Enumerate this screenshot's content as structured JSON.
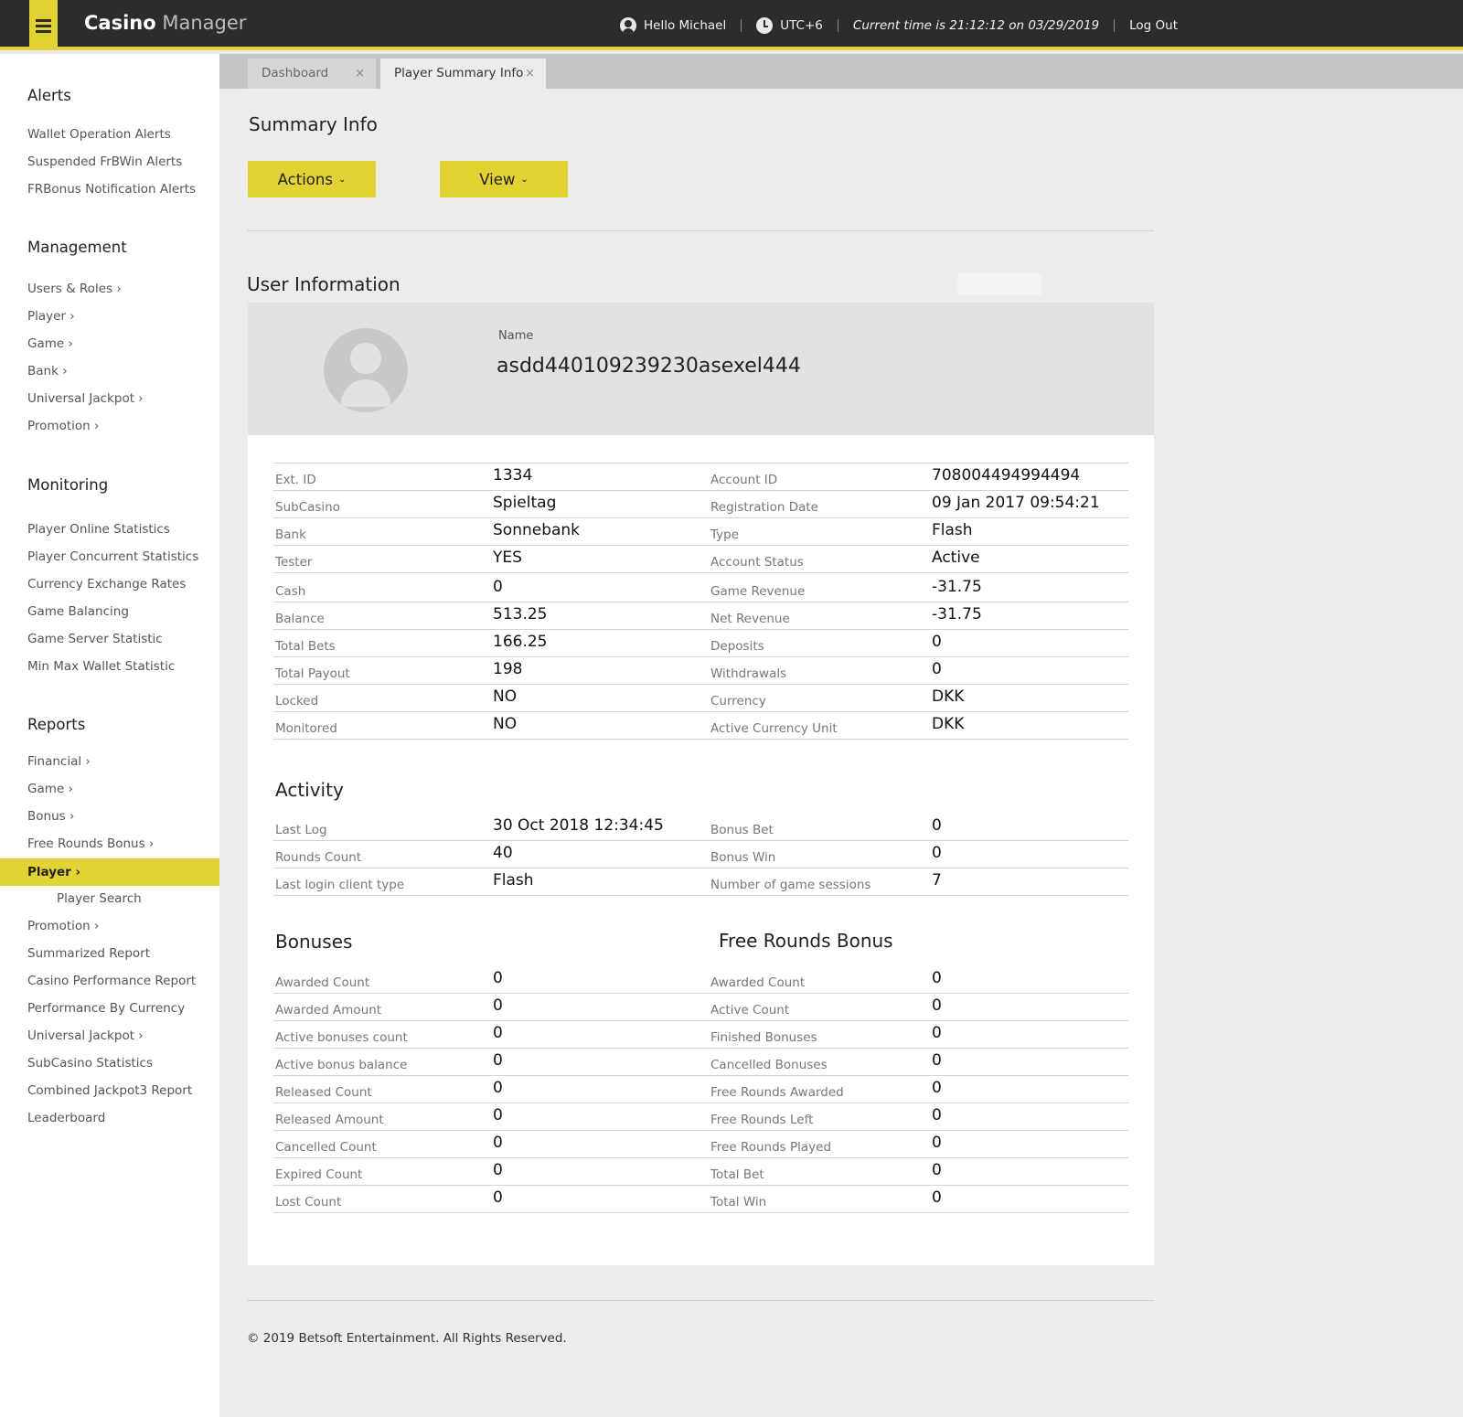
{
  "header": {
    "brand_bold": "Casino",
    "brand_light": "Manager",
    "greeting": "Hello Michael",
    "timezone": "UTC+6",
    "current_time": "Current time is 21:12:12 on 03/29/2019",
    "logout": "Log Out"
  },
  "sidebar": {
    "alerts": {
      "title": "Alerts",
      "items": [
        "Wallet Operation Alerts",
        "Suspended FrBWin Alerts",
        "FRBonus Notification Alerts"
      ]
    },
    "management": {
      "title": "Management",
      "items": [
        "Users & Roles ›",
        "Player ›",
        "Game ›",
        "Bank ›",
        "Universal Jackpot ›",
        "Promotion ›"
      ]
    },
    "monitoring": {
      "title": "Monitoring",
      "items": [
        "Player Online Statistics",
        "Player Concurrent Statistics",
        "Currency Exchange Rates",
        "Game Balancing",
        "Game Server Statistic",
        "Min Max Wallet Statistic"
      ]
    },
    "reports": {
      "title": "Reports",
      "items_before": [
        "Financial ›",
        "Game ›",
        "Bonus ›",
        "Free Rounds Bonus ›"
      ],
      "active": "Player ›",
      "sub_item": "Player Search",
      "items_after": [
        "Promotion ›",
        "Summarized Report",
        "Casino Performance Report",
        "Performance By Currency",
        "Universal Jackpot ›",
        "SubCasino Statistics",
        "Combined Jackpot3 Report",
        "Leaderboard"
      ]
    }
  },
  "tabs": [
    {
      "label": "Dashboard",
      "close": "×"
    },
    {
      "label": "Player Summary Info",
      "close": "×"
    }
  ],
  "page": {
    "title": "Summary Info",
    "actions_label": "Actions",
    "view_label": "View",
    "chevron": "⌄",
    "section_title": "User Information"
  },
  "user": {
    "name_label": "Name",
    "name": "asdd440109239230asexel444"
  },
  "info_rows": [
    {
      "l1": "Ext. ID",
      "v1": "1334",
      "l2": "Account ID",
      "v2": "708004494994494"
    },
    {
      "l1": "SubCasino",
      "v1": "Spieltag",
      "l2": "Registration Date",
      "v2": "09 Jan 2017 09:54:21"
    },
    {
      "l1": "Bank",
      "v1": "Sonnebank",
      "l2": "Type",
      "v2": "Flash"
    },
    {
      "l1": "Tester",
      "v1": "YES",
      "l2": "Account Status",
      "v2": "Active"
    }
  ],
  "money_rows": [
    {
      "l1": "Cash",
      "v1": "0",
      "l2": "Game Revenue",
      "v2": "-31.75"
    },
    {
      "l1": "Balance",
      "v1": "513.25",
      "l2": "Net Revenue",
      "v2": "-31.75"
    },
    {
      "l1": "Total Bets",
      "v1": "166.25",
      "l2": "Deposits",
      "v2": "0"
    },
    {
      "l1": "Total Payout",
      "v1": "198",
      "l2": "Withdrawals",
      "v2": "0"
    },
    {
      "l1": "Locked",
      "v1": "NO",
      "l2": "Currency",
      "v2": "DKK"
    },
    {
      "l1": "Monitored",
      "v1": "NO",
      "l2": "Active Currency Unit",
      "v2": "DKK"
    }
  ],
  "activity": {
    "title": "Activity",
    "rows": [
      {
        "l1": "Last Log",
        "v1": "30 Oct 2018 12:34:45",
        "l2": "Bonus Bet",
        "v2": "0"
      },
      {
        "l1": "Rounds Count",
        "v1": "40",
        "l2": "Bonus Win",
        "v2": "0"
      },
      {
        "l1": "Last login client type",
        "v1": "Flash",
        "l2": "Number of game sessions",
        "v2": "7"
      }
    ]
  },
  "bonuses": {
    "title": "Bonuses",
    "free_rounds_title": "Free Rounds Bonus",
    "rows": [
      {
        "l1": "Awarded Count",
        "v1": "0",
        "l2": "Awarded Count",
        "v2": "0"
      },
      {
        "l1": "Awarded Amount",
        "v1": "0",
        "l2": "Active Count",
        "v2": "0"
      },
      {
        "l1": "Active bonuses count",
        "v1": "0",
        "l2": "Finished Bonuses",
        "v2": "0"
      },
      {
        "l1": "Active bonus balance",
        "v1": "0",
        "l2": "Cancelled Bonuses",
        "v2": "0"
      },
      {
        "l1": "Released Count",
        "v1": "0",
        "l2": "Free Rounds Awarded",
        "v2": "0"
      },
      {
        "l1": "Released Amount",
        "v1": "0",
        "l2": "Free Rounds Left",
        "v2": "0"
      },
      {
        "l1": "Cancelled Count",
        "v1": "0",
        "l2": "Free Rounds Played",
        "v2": "0"
      },
      {
        "l1": "Expired Count",
        "v1": "0",
        "l2": "Total Bet",
        "v2": "0"
      },
      {
        "l1": "Lost Count",
        "v1": "0",
        "l2": "Total Win",
        "v2": "0"
      }
    ]
  },
  "footer": "© 2019 Betsoft Entertainment. All Rights Reserved.",
  "colors": {
    "accent": "#e2d234",
    "topbar": "#2c2c2c",
    "background": "#ececec"
  }
}
